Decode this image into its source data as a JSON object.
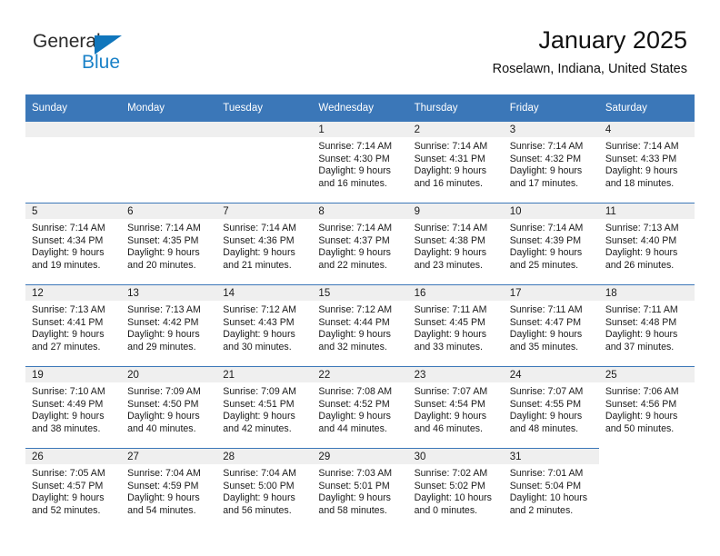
{
  "logo": {
    "word_top": "General",
    "word_bottom": "Blue",
    "triangle_color": "#1076bc",
    "blue_text_color": "#1b82c8",
    "icon": "general-blue-logo"
  },
  "header": {
    "title": "January 2025",
    "subtitle": "Roselawn, Indiana, United States"
  },
  "theme": {
    "header_blue": "#3b77b8",
    "daynum_band": "#efefef",
    "cell_bg": "#ffffff",
    "text": "#1a1a1a"
  },
  "calendar": {
    "weekday_headers": [
      "Sunday",
      "Monday",
      "Tuesday",
      "Wednesday",
      "Thursday",
      "Friday",
      "Saturday"
    ],
    "weeks": [
      [
        {
          "day": "",
          "empty": true
        },
        {
          "day": "",
          "empty": true
        },
        {
          "day": "",
          "empty": true
        },
        {
          "day": "1",
          "sunrise": "Sunrise: 7:14 AM",
          "sunset": "Sunset: 4:30 PM",
          "daylight1": "Daylight: 9 hours",
          "daylight2": "and 16 minutes."
        },
        {
          "day": "2",
          "sunrise": "Sunrise: 7:14 AM",
          "sunset": "Sunset: 4:31 PM",
          "daylight1": "Daylight: 9 hours",
          "daylight2": "and 16 minutes."
        },
        {
          "day": "3",
          "sunrise": "Sunrise: 7:14 AM",
          "sunset": "Sunset: 4:32 PM",
          "daylight1": "Daylight: 9 hours",
          "daylight2": "and 17 minutes."
        },
        {
          "day": "4",
          "sunrise": "Sunrise: 7:14 AM",
          "sunset": "Sunset: 4:33 PM",
          "daylight1": "Daylight: 9 hours",
          "daylight2": "and 18 minutes."
        }
      ],
      [
        {
          "day": "5",
          "sunrise": "Sunrise: 7:14 AM",
          "sunset": "Sunset: 4:34 PM",
          "daylight1": "Daylight: 9 hours",
          "daylight2": "and 19 minutes."
        },
        {
          "day": "6",
          "sunrise": "Sunrise: 7:14 AM",
          "sunset": "Sunset: 4:35 PM",
          "daylight1": "Daylight: 9 hours",
          "daylight2": "and 20 minutes."
        },
        {
          "day": "7",
          "sunrise": "Sunrise: 7:14 AM",
          "sunset": "Sunset: 4:36 PM",
          "daylight1": "Daylight: 9 hours",
          "daylight2": "and 21 minutes."
        },
        {
          "day": "8",
          "sunrise": "Sunrise: 7:14 AM",
          "sunset": "Sunset: 4:37 PM",
          "daylight1": "Daylight: 9 hours",
          "daylight2": "and 22 minutes."
        },
        {
          "day": "9",
          "sunrise": "Sunrise: 7:14 AM",
          "sunset": "Sunset: 4:38 PM",
          "daylight1": "Daylight: 9 hours",
          "daylight2": "and 23 minutes."
        },
        {
          "day": "10",
          "sunrise": "Sunrise: 7:14 AM",
          "sunset": "Sunset: 4:39 PM",
          "daylight1": "Daylight: 9 hours",
          "daylight2": "and 25 minutes."
        },
        {
          "day": "11",
          "sunrise": "Sunrise: 7:13 AM",
          "sunset": "Sunset: 4:40 PM",
          "daylight1": "Daylight: 9 hours",
          "daylight2": "and 26 minutes."
        }
      ],
      [
        {
          "day": "12",
          "sunrise": "Sunrise: 7:13 AM",
          "sunset": "Sunset: 4:41 PM",
          "daylight1": "Daylight: 9 hours",
          "daylight2": "and 27 minutes."
        },
        {
          "day": "13",
          "sunrise": "Sunrise: 7:13 AM",
          "sunset": "Sunset: 4:42 PM",
          "daylight1": "Daylight: 9 hours",
          "daylight2": "and 29 minutes."
        },
        {
          "day": "14",
          "sunrise": "Sunrise: 7:12 AM",
          "sunset": "Sunset: 4:43 PM",
          "daylight1": "Daylight: 9 hours",
          "daylight2": "and 30 minutes."
        },
        {
          "day": "15",
          "sunrise": "Sunrise: 7:12 AM",
          "sunset": "Sunset: 4:44 PM",
          "daylight1": "Daylight: 9 hours",
          "daylight2": "and 32 minutes."
        },
        {
          "day": "16",
          "sunrise": "Sunrise: 7:11 AM",
          "sunset": "Sunset: 4:45 PM",
          "daylight1": "Daylight: 9 hours",
          "daylight2": "and 33 minutes."
        },
        {
          "day": "17",
          "sunrise": "Sunrise: 7:11 AM",
          "sunset": "Sunset: 4:47 PM",
          "daylight1": "Daylight: 9 hours",
          "daylight2": "and 35 minutes."
        },
        {
          "day": "18",
          "sunrise": "Sunrise: 7:11 AM",
          "sunset": "Sunset: 4:48 PM",
          "daylight1": "Daylight: 9 hours",
          "daylight2": "and 37 minutes."
        }
      ],
      [
        {
          "day": "19",
          "sunrise": "Sunrise: 7:10 AM",
          "sunset": "Sunset: 4:49 PM",
          "daylight1": "Daylight: 9 hours",
          "daylight2": "and 38 minutes."
        },
        {
          "day": "20",
          "sunrise": "Sunrise: 7:09 AM",
          "sunset": "Sunset: 4:50 PM",
          "daylight1": "Daylight: 9 hours",
          "daylight2": "and 40 minutes."
        },
        {
          "day": "21",
          "sunrise": "Sunrise: 7:09 AM",
          "sunset": "Sunset: 4:51 PM",
          "daylight1": "Daylight: 9 hours",
          "daylight2": "and 42 minutes."
        },
        {
          "day": "22",
          "sunrise": "Sunrise: 7:08 AM",
          "sunset": "Sunset: 4:52 PM",
          "daylight1": "Daylight: 9 hours",
          "daylight2": "and 44 minutes."
        },
        {
          "day": "23",
          "sunrise": "Sunrise: 7:07 AM",
          "sunset": "Sunset: 4:54 PM",
          "daylight1": "Daylight: 9 hours",
          "daylight2": "and 46 minutes."
        },
        {
          "day": "24",
          "sunrise": "Sunrise: 7:07 AM",
          "sunset": "Sunset: 4:55 PM",
          "daylight1": "Daylight: 9 hours",
          "daylight2": "and 48 minutes."
        },
        {
          "day": "25",
          "sunrise": "Sunrise: 7:06 AM",
          "sunset": "Sunset: 4:56 PM",
          "daylight1": "Daylight: 9 hours",
          "daylight2": "and 50 minutes."
        }
      ],
      [
        {
          "day": "26",
          "sunrise": "Sunrise: 7:05 AM",
          "sunset": "Sunset: 4:57 PM",
          "daylight1": "Daylight: 9 hours",
          "daylight2": "and 52 minutes."
        },
        {
          "day": "27",
          "sunrise": "Sunrise: 7:04 AM",
          "sunset": "Sunset: 4:59 PM",
          "daylight1": "Daylight: 9 hours",
          "daylight2": "and 54 minutes."
        },
        {
          "day": "28",
          "sunrise": "Sunrise: 7:04 AM",
          "sunset": "Sunset: 5:00 PM",
          "daylight1": "Daylight: 9 hours",
          "daylight2": "and 56 minutes."
        },
        {
          "day": "29",
          "sunrise": "Sunrise: 7:03 AM",
          "sunset": "Sunset: 5:01 PM",
          "daylight1": "Daylight: 9 hours",
          "daylight2": "and 58 minutes."
        },
        {
          "day": "30",
          "sunrise": "Sunrise: 7:02 AM",
          "sunset": "Sunset: 5:02 PM",
          "daylight1": "Daylight: 10 hours",
          "daylight2": "and 0 minutes."
        },
        {
          "day": "31",
          "sunrise": "Sunrise: 7:01 AM",
          "sunset": "Sunset: 5:04 PM",
          "daylight1": "Daylight: 10 hours",
          "daylight2": "and 2 minutes."
        },
        {
          "day": "",
          "blank": true
        }
      ]
    ]
  }
}
